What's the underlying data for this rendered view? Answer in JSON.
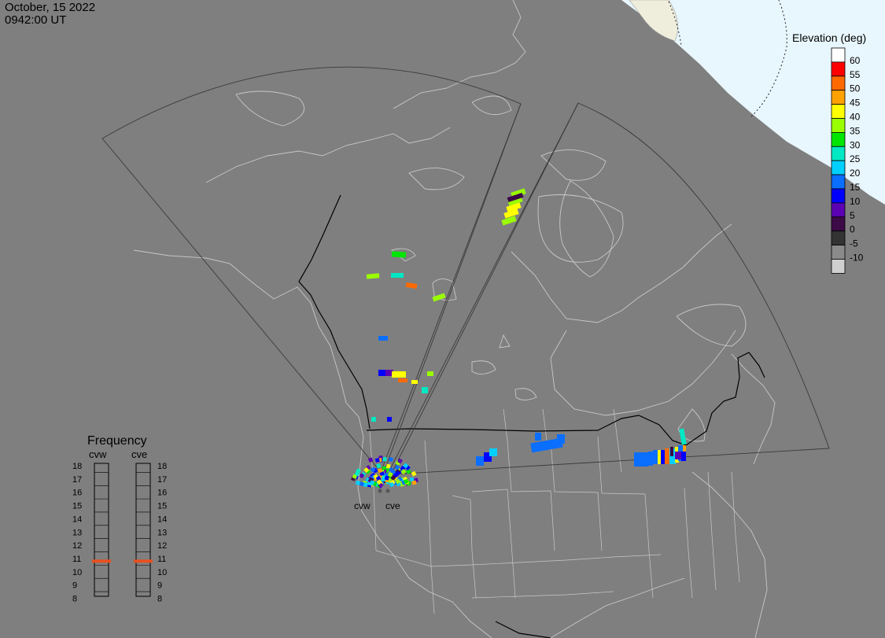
{
  "header": {
    "date": "October, 15 2022",
    "time": "0942:00 UT"
  },
  "colors": {
    "background": "#7f7f7f",
    "land_lines": "#c8c8c8",
    "borders": "#000000",
    "polar_cap": "#e8f6fd",
    "ice": "#efeedd",
    "frequency_marker": "#e85020"
  },
  "radars": [
    {
      "code": "cvw",
      "label": "cvw"
    },
    {
      "code": "cve",
      "label": "cve"
    }
  ],
  "elevation_legend": {
    "title": "Elevation (deg)",
    "entries": [
      {
        "label": "60",
        "color": "#ffffff"
      },
      {
        "label": "55",
        "color": "#ff0000"
      },
      {
        "label": "50",
        "color": "#ff6a00"
      },
      {
        "label": "45",
        "color": "#ffa200"
      },
      {
        "label": "40",
        "color": "#ffff00"
      },
      {
        "label": "35",
        "color": "#9aff00"
      },
      {
        "label": "30",
        "color": "#00e600"
      },
      {
        "label": "25",
        "color": "#00e8c4"
      },
      {
        "label": "20",
        "color": "#00d0ff"
      },
      {
        "label": "15",
        "color": "#0a6eff"
      },
      {
        "label": "10",
        "color": "#0000ff"
      },
      {
        "label": "5",
        "color": "#5c00b4"
      },
      {
        "label": "0",
        "color": "#3c0a46"
      },
      {
        "label": "-5",
        "color": "#333333"
      },
      {
        "label": "-10",
        "color": "#8a8a8a"
      },
      {
        "label": "",
        "color": "#d0d0d0"
      }
    ]
  },
  "frequency_panel": {
    "title": "Frequency",
    "channels": [
      {
        "label": "cvw",
        "value_mhz": 10.8
      },
      {
        "label": "cve",
        "value_mhz": 10.8
      }
    ],
    "ticks": [
      "18",
      "17",
      "16",
      "15",
      "14",
      "13",
      "12",
      "11",
      "10",
      "9",
      "8"
    ]
  },
  "scatter_cells": {
    "cvw": [
      [
        "#9aff00",
        0
      ],
      [
        "#9aff00",
        0
      ],
      [
        "#ffff00",
        0
      ],
      [
        "#ffff00",
        0
      ],
      [
        "#3c0a46",
        0
      ],
      [
        "#9aff00",
        0
      ],
      [
        "#00e600",
        0
      ],
      [
        "#00e8c4",
        0
      ],
      [
        "#9aff00",
        0
      ],
      [
        "#ff6a00",
        0
      ],
      [
        "#9aff00",
        0
      ],
      [
        "#0a6eff",
        0
      ],
      [
        "#0000ff",
        0
      ],
      [
        "#5c00b4",
        0
      ],
      [
        "#ffff00",
        0
      ],
      [
        "#ff6a00",
        0
      ],
      [
        "#ffff00",
        0
      ],
      [
        "#00e8c4",
        0
      ],
      [
        "#9aff00",
        0
      ],
      [
        "#00e8c4",
        0
      ],
      [
        "#0000ff",
        0
      ]
    ],
    "cve": [
      [
        "#0a6eff",
        0
      ],
      [
        "#0000ff",
        0
      ],
      [
        "#00d0ff",
        0
      ],
      [
        "#0a6eff",
        0
      ],
      [
        "#0a6eff",
        0
      ],
      [
        "#0a6eff",
        0
      ],
      [
        "#00e8c4",
        0
      ],
      [
        "#0a6eff",
        0
      ],
      [
        "#0a6eff",
        0
      ],
      [
        "#0a6eff",
        0
      ],
      [
        "#0a6eff",
        0
      ],
      [
        "#ffff00",
        0
      ],
      [
        "#0000ff",
        0
      ],
      [
        "#ff6a00",
        0
      ],
      [
        "#00d0ff",
        0
      ],
      [
        "#ffff00",
        0
      ],
      [
        "#0a6eff",
        0
      ],
      [
        "#ffa200",
        0
      ],
      [
        "#5c00b4",
        0
      ],
      [
        "#0000ff",
        0
      ],
      [
        "#3c0a46",
        0
      ]
    ]
  }
}
